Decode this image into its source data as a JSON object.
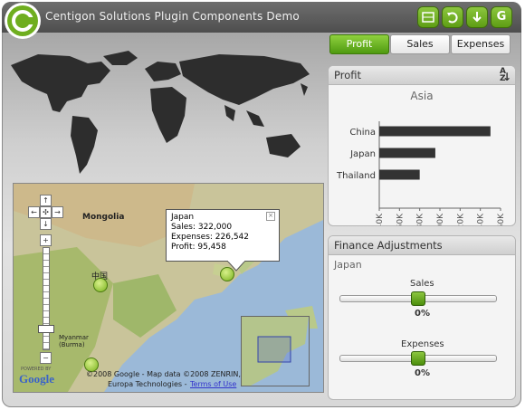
{
  "app": {
    "title": "Centigon Solutions Plugin Components Demo"
  },
  "toolbar": {
    "icons": [
      "grid-icon",
      "refresh-icon",
      "download-icon",
      "g-icon"
    ],
    "g_label": "G"
  },
  "tabs": [
    {
      "label": "Profit",
      "active": true
    },
    {
      "label": "Sales",
      "active": false
    },
    {
      "label": "Expenses",
      "active": false
    }
  ],
  "profit_panel": {
    "title": "Profit",
    "sort_glyph": "A↓Z"
  },
  "chart_data": {
    "type": "bar",
    "title": "Asia",
    "categories": [
      "China",
      "Japan",
      "Thailand"
    ],
    "values": [
      150000,
      95458,
      80000
    ],
    "xlim": [
      40000,
      160000
    ],
    "ticks": [
      "40K",
      "60K",
      "80K",
      "100K",
      "120K",
      "140K",
      "160K"
    ],
    "orientation": "horizontal",
    "bar_color": "#333333"
  },
  "map_popup": {
    "country": "Japan",
    "sales": "Sales: 322,000",
    "expenses": "Expenses: 226,542",
    "profit": "Profit: 95,458"
  },
  "gmap": {
    "label_mongolia": "Mongolia",
    "label_china": "中国",
    "label_myanmar": "Myanmar (Burma)",
    "copyright": "©2008 Google - Map data ©2008  ZENRIN,",
    "copyright2": "Europa Technologies -",
    "terms": "Terms of Use",
    "powered": "POWERED BY",
    "google": "Google"
  },
  "finance_panel": {
    "title": "Finance Adjustments",
    "region": "Japan",
    "sales_label": "Sales",
    "sales_value": "0%",
    "expenses_label": "Expenses",
    "expenses_value": "0%"
  }
}
